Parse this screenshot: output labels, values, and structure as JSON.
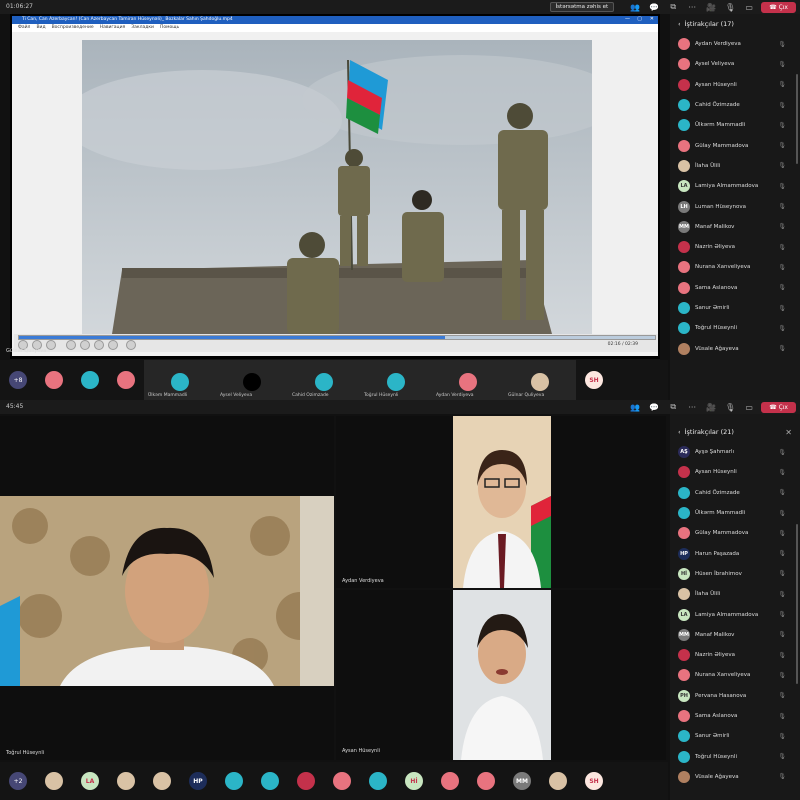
{
  "top": {
    "time": "01:06:27",
    "raise_label": "İstərsətma zəhis et",
    "leave_label": "Çıx",
    "participants_title": "İştirakçılar",
    "participants_count": "(17)",
    "share_title": "Ti Can, Can Azerbaycan! (Can Azerbaycan Tamiran Hüseynəli)_ Bozkalar Sahın Şahdoğlu.mp4",
    "share_menu": [
      "Файл",
      "Вид",
      "Воспроизведение",
      "Навигация",
      "Закладки",
      "Помощь"
    ],
    "presenter_label": "Gülnar Quliyeva",
    "timecode": "02:16 / 02:39",
    "participants": [
      {
        "name": "Aydan Verdiyeva",
        "initials": "",
        "color": "#e8737f"
      },
      {
        "name": "Aysel Veliyeva",
        "initials": "",
        "color": "#e8737f"
      },
      {
        "name": "Aysan Hüseynli",
        "initials": "",
        "color": "#c4314b"
      },
      {
        "name": "Cahid Özimzade",
        "initials": "",
        "color": "#2bb5c7"
      },
      {
        "name": "Ülkərm Mammadli",
        "initials": "",
        "color": "#2bb5c7"
      },
      {
        "name": "Gülay Mammadova",
        "initials": "",
        "color": "#e8737f"
      },
      {
        "name": "İlaha Ülili",
        "initials": "",
        "color": "#d9c2a5"
      },
      {
        "name": "Lamiya Almammadova",
        "initials": "LA",
        "color": "#c8e6c0"
      },
      {
        "name": "Luman Hüseynova",
        "initials": "LH",
        "color": "#7a7a7a"
      },
      {
        "name": "Manaf Malikov",
        "initials": "MM",
        "color": "#7a7a7a"
      },
      {
        "name": "Nazrin Əliyeva",
        "initials": "",
        "color": "#c4314b"
      },
      {
        "name": "Nurana Xanveliyeva",
        "initials": "",
        "color": "#e8737f"
      },
      {
        "name": "Sama Aslanova",
        "initials": "",
        "color": "#e8737f"
      },
      {
        "name": "Sanur Əmirli",
        "initials": "",
        "color": "#2bb5c7"
      },
      {
        "name": "Toğrul Hüseynli",
        "initials": "",
        "color": "#2bb5c7"
      },
      {
        "name": "Vüsale Ağayeva",
        "initials": "",
        "color": "#b08060"
      }
    ],
    "strip": [
      {
        "type": "badge",
        "label": "+8"
      },
      {
        "type": "av",
        "color": "#e8737f"
      },
      {
        "type": "av",
        "color": "#2bb5c7"
      },
      {
        "type": "av",
        "color": "#e8737f"
      },
      {
        "type": "wide",
        "color": "#2bb5c7",
        "label": "Ülkəm Mammadli"
      },
      {
        "type": "wide",
        "color": "#000",
        "label": "Aysel Veliyeva"
      },
      {
        "type": "wide",
        "color": "#2bb5c7",
        "label": "Cahid Ozimzade"
      },
      {
        "type": "wide",
        "color": "#2bb5c7",
        "label": "Toğrul Hüseynli"
      },
      {
        "type": "wide",
        "color": "#e8737f",
        "label": "Aydan Verdiyeva"
      },
      {
        "type": "wide",
        "color": "#d9c2a5",
        "label": "Gülnar Quliyeva"
      },
      {
        "type": "av",
        "color": "#fde7e0",
        "label": "SH"
      }
    ]
  },
  "bottom": {
    "time": "45:45",
    "participants_title": "İştirakçılar",
    "participants_count": "(21)",
    "participants": [
      {
        "name": "Ayşə Şahmarlı",
        "initials": "AŞ",
        "color": "#2b2b5a"
      },
      {
        "name": "Aysan Hüseynli",
        "initials": "",
        "color": "#c4314b"
      },
      {
        "name": "Cahid Özimzade",
        "initials": "",
        "color": "#2bb5c7"
      },
      {
        "name": "Ülkərm Mammadli",
        "initials": "",
        "color": "#2bb5c7"
      },
      {
        "name": "Gülay Mammadova",
        "initials": "",
        "color": "#e8737f"
      },
      {
        "name": "Harun Paşazada",
        "initials": "HP",
        "color": "#1d2d5a"
      },
      {
        "name": "Hüsen İbrahimov",
        "initials": "Hİ",
        "color": "#c8e6c0"
      },
      {
        "name": "İlaha Ülili",
        "initials": "",
        "color": "#d9c2a5"
      },
      {
        "name": "Lamiya Almammadova",
        "initials": "LA",
        "color": "#c8e6c0"
      },
      {
        "name": "Manaf Malikov",
        "initials": "MM",
        "color": "#7a7a7a"
      },
      {
        "name": "Nazrin Əliyeva",
        "initials": "",
        "color": "#c4314b"
      },
      {
        "name": "Nurana Xanveliyeva",
        "initials": "",
        "color": "#e8737f"
      },
      {
        "name": "Pervana Hasanova",
        "initials": "PH",
        "color": "#c8e6c0"
      },
      {
        "name": "Sama Aslanova",
        "initials": "",
        "color": "#e8737f"
      },
      {
        "name": "Sanur Əmirli",
        "initials": "",
        "color": "#2bb5c7"
      },
      {
        "name": "Toğrul Hüseynli",
        "initials": "",
        "color": "#2bb5c7"
      },
      {
        "name": "Vüsale Ağayeva",
        "initials": "",
        "color": "#b08060"
      }
    ],
    "video_labels": {
      "main": "Toğrul Hüseynli",
      "top_right": "Aydan Verdiyeva",
      "bottom_right": "Aysan Hüseynli"
    },
    "strip": [
      {
        "type": "badge",
        "label": "+2"
      },
      {
        "type": "av",
        "color": "#d9c2a5"
      },
      {
        "type": "av",
        "color": "#c8e6c0",
        "label": "LA"
      },
      {
        "type": "av",
        "color": "#d9c2a5"
      },
      {
        "type": "av",
        "color": "#d9c2a5"
      },
      {
        "type": "av",
        "color": "#1d2d5a",
        "label": "HP"
      },
      {
        "type": "av",
        "color": "#2bb5c7"
      },
      {
        "type": "av",
        "color": "#2bb5c7"
      },
      {
        "type": "av",
        "color": "#c4314b"
      },
      {
        "type": "av",
        "color": "#e8737f"
      },
      {
        "type": "av",
        "color": "#2bb5c7"
      },
      {
        "type": "av",
        "color": "#c8e6c0",
        "label": "Hİ"
      },
      {
        "type": "av",
        "color": "#e8737f"
      },
      {
        "type": "av",
        "color": "#e8737f"
      },
      {
        "type": "av",
        "color": "#7a7a7a",
        "label": "MM"
      },
      {
        "type": "av",
        "color": "#d9c2a5"
      },
      {
        "type": "av",
        "color": "#fde7e0",
        "label": "SH"
      }
    ]
  }
}
